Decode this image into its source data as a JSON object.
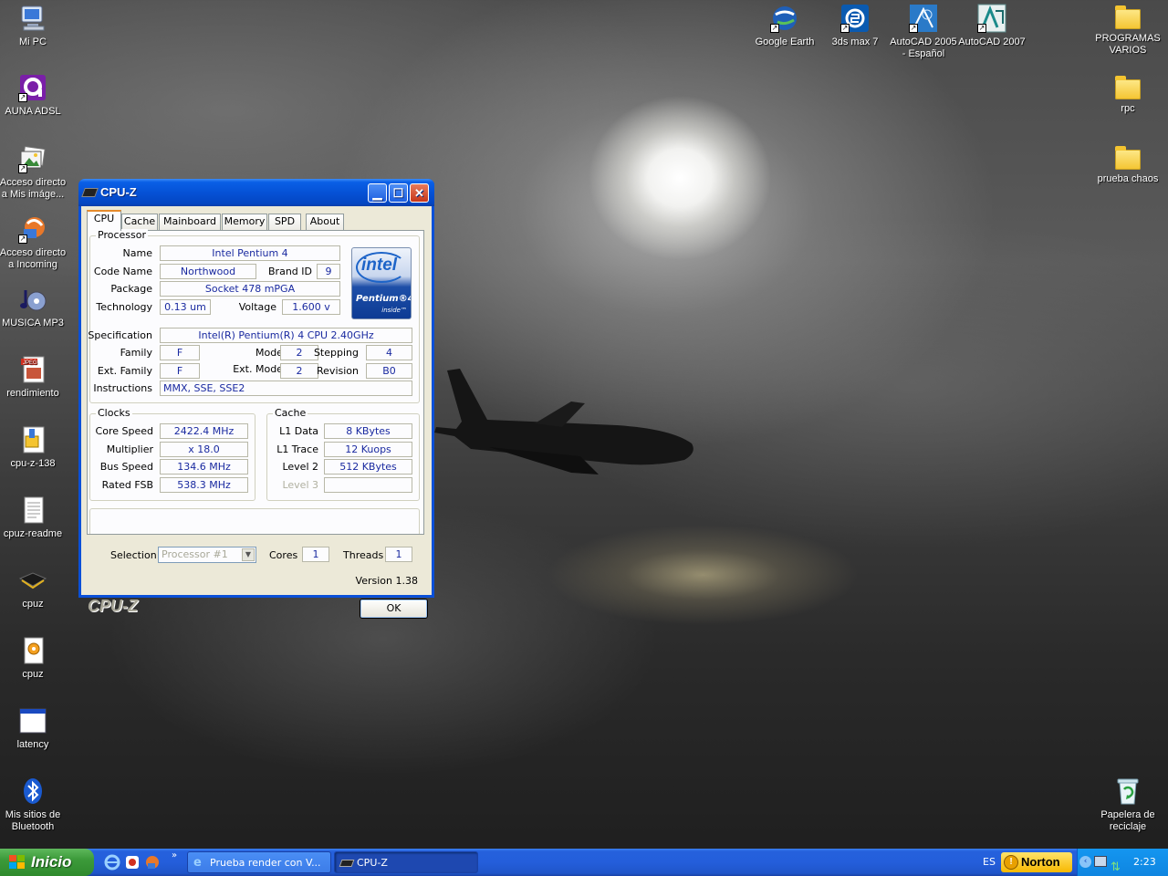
{
  "desktop": {
    "left_icons": [
      {
        "label": "Mi PC",
        "icon": "computer-icon"
      },
      {
        "label": "AUNA ADSL",
        "icon": "auna-icon"
      },
      {
        "label": "Acceso directo a Mis imáge...",
        "icon": "pictures-icon"
      },
      {
        "label": "Acceso directo a Incoming",
        "icon": "incoming-icon"
      },
      {
        "label": "MUSICA MP3",
        "icon": "music-icon"
      },
      {
        "label": "rendimiento",
        "icon": "jpeg-file-icon"
      },
      {
        "label": "cpu-z-138",
        "icon": "archive-icon"
      },
      {
        "label": "cpuz-readme",
        "icon": "text-file-icon"
      },
      {
        "label": "cpuz",
        "icon": "chip-icon"
      },
      {
        "label": "cpuz",
        "icon": "config-file-icon"
      },
      {
        "label": "latency",
        "icon": "window-icon"
      },
      {
        "label": "Mis sitios de Bluetooth",
        "icon": "bluetooth-icon"
      }
    ],
    "top_icons": [
      {
        "label": "Google Earth",
        "icon": "google-earth-icon"
      },
      {
        "label": "3ds max 7",
        "icon": "3ds-max-icon"
      },
      {
        "label": "AutoCAD 2005 - Español",
        "icon": "autocad-2005-icon"
      },
      {
        "label": "AutoCAD 2007",
        "icon": "autocad-2007-icon"
      }
    ],
    "right_icons": [
      {
        "label": "PROGRAMAS VARIOS",
        "icon": "folder-icon"
      },
      {
        "label": "rpc",
        "icon": "folder-icon"
      },
      {
        "label": "prueba chaos",
        "icon": "folder-icon"
      },
      {
        "label": "Papelera de reciclaje",
        "icon": "recycle-bin-icon"
      }
    ]
  },
  "window": {
    "title": "CPU-Z",
    "tabs": [
      "CPU",
      "Cache",
      "Mainboard",
      "Memory",
      "SPD",
      "About"
    ],
    "active_tab": "CPU",
    "processor": {
      "group_title": "Processor",
      "name_label": "Name",
      "name": "Intel Pentium 4",
      "codename_label": "Code Name",
      "codename": "Northwood",
      "brandid_label": "Brand ID",
      "brandid": "9",
      "package_label": "Package",
      "package": "Socket 478 mPGA",
      "technology_label": "Technology",
      "technology": "0.13 um",
      "voltage_label": "Voltage",
      "voltage": "1.600 v",
      "spec_label": "Specification",
      "spec": "Intel(R) Pentium(R) 4 CPU 2.40GHz",
      "family_label": "Family",
      "family": "F",
      "model_label": "Model",
      "model": "2",
      "stepping_label": "Stepping",
      "stepping": "4",
      "extfamily_label": "Ext. Family",
      "extfamily": "F",
      "extmodel_label": "Ext. Model",
      "extmodel": "2",
      "revision_label": "Revision",
      "revision": "B0",
      "instructions_label": "Instructions",
      "instructions": "MMX, SSE, SSE2",
      "logo_brand": "intel",
      "logo_line": "Pentium®4",
      "logo_inside": "inside™"
    },
    "clocks": {
      "group_title": "Clocks",
      "core_label": "Core Speed",
      "core": "2422.4 MHz",
      "mult_label": "Multiplier",
      "mult": "x 18.0",
      "bus_label": "Bus Speed",
      "bus": "134.6 MHz",
      "fsb_label": "Rated FSB",
      "fsb": "538.3 MHz"
    },
    "cache": {
      "group_title": "Cache",
      "l1d_label": "L1 Data",
      "l1d": "8 KBytes",
      "l1t_label": "L1 Trace",
      "l1t": "12 Kuops",
      "l2_label": "Level 2",
      "l2": "512 KBytes",
      "l3_label": "Level 3",
      "l3": ""
    },
    "selection_label": "Selection",
    "selection": "Processor #1",
    "cores_label": "Cores",
    "cores": "1",
    "threads_label": "Threads",
    "threads": "1",
    "version": "Version 1.38",
    "footer_logo": "CPU-Z",
    "ok_label": "OK"
  },
  "taskbar": {
    "start_label": "Inicio",
    "tasks": [
      {
        "label": "Prueba render con V...",
        "icon": "ie-icon"
      },
      {
        "label": "CPU-Z",
        "icon": "chip-icon"
      }
    ],
    "language": "ES",
    "norton_label": "Norton",
    "clock": "2:23"
  }
}
